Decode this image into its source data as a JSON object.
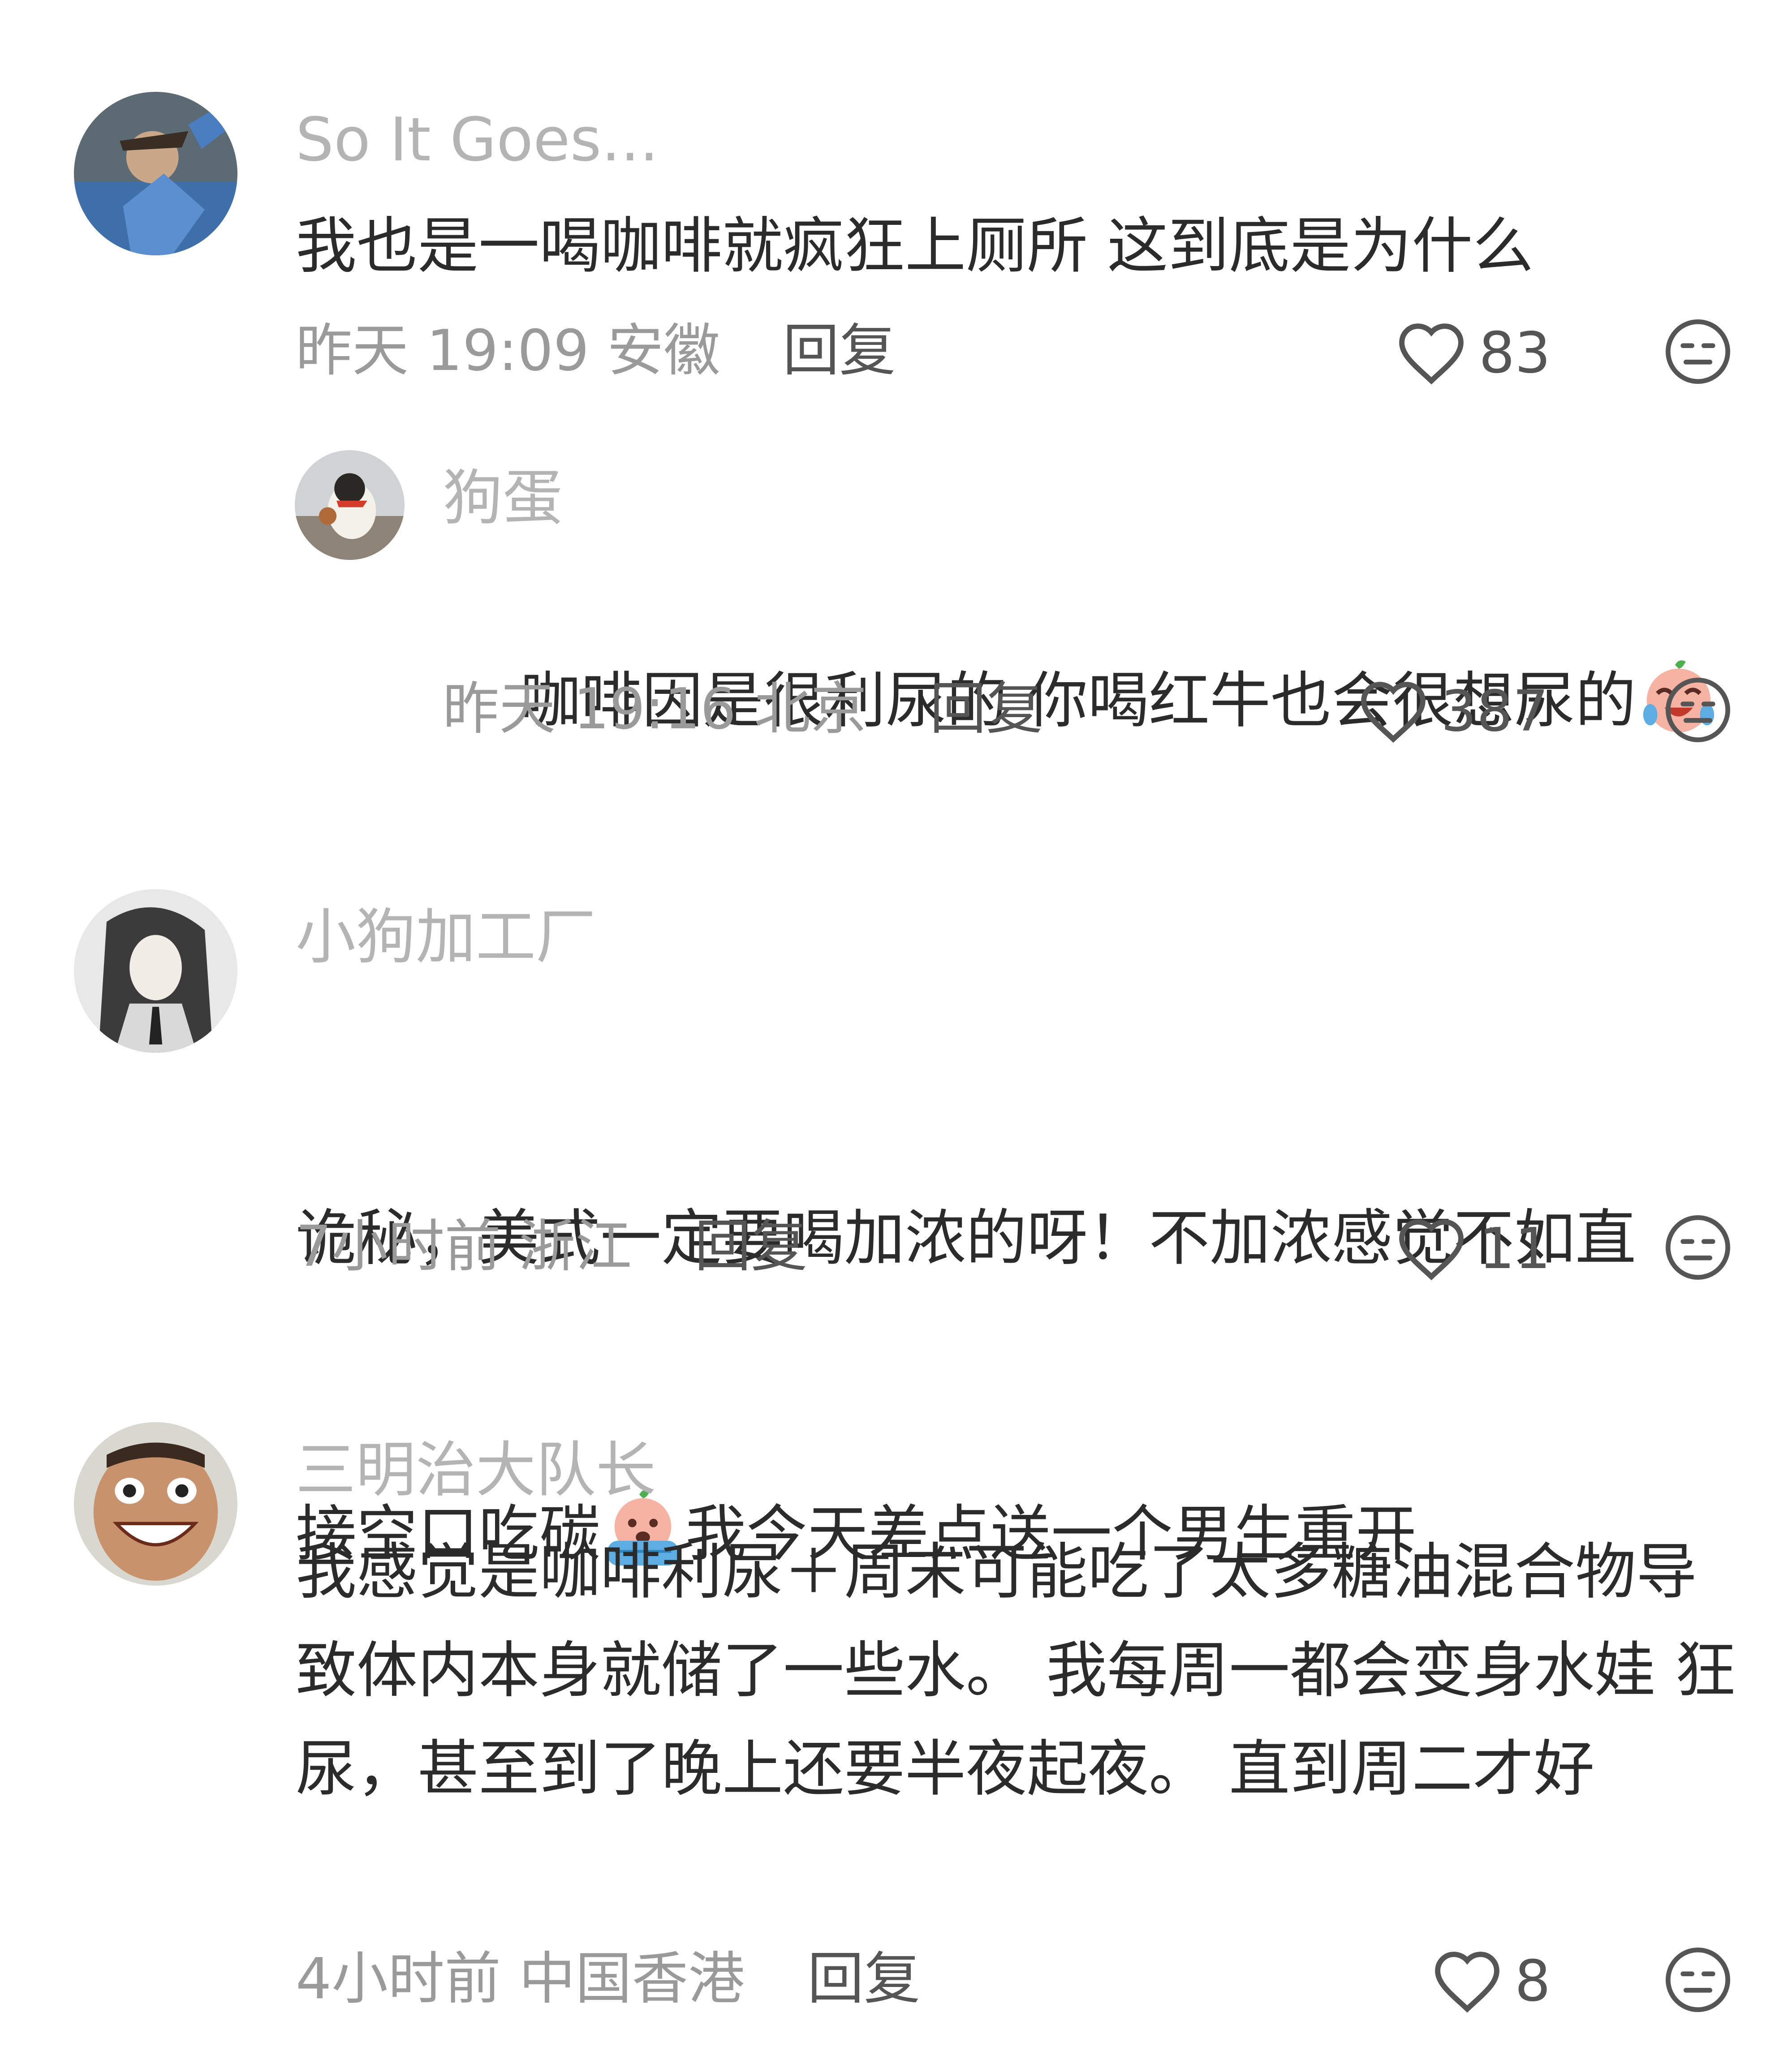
{
  "comments": [
    {
      "username": "So It Goes...",
      "text": "我也是一喝咖啡就疯狂上厕所 这到底是为什么",
      "time": "昨天 19:09",
      "location": "安徽",
      "reply_label": "回复",
      "likes": "83"
    },
    {
      "username": "狗蛋",
      "text": "咖啡因是很利尿的 你喝红牛也会很想尿的",
      "time": "昨天 19:16",
      "location": "北京",
      "reply_label": "回复",
      "likes": "387"
    },
    {
      "username": "小狗加工厂",
      "text_line1": "诡秘，美式一定要喝加浓的呀！不加浓感觉不如直",
      "text_line2_a": "接空口吃碳",
      "text_line2_b": "我今天差点送一个男生重开",
      "time": "7小时前",
      "location": "浙江",
      "reply_label": "回复",
      "likes": "11"
    },
    {
      "username": "三明治大队长",
      "text": "我感觉是咖啡利尿＋周末可能吃了太多糖油混合物导致体内本身就储了一些水。 我每周一都会变身水娃 狂尿，甚至到了晚上还要半夜起夜。 直到周二才好",
      "time": "4小时前",
      "location": "中国香港",
      "reply_label": "回复",
      "likes": "8"
    }
  ],
  "icons": {
    "like": "heart-outline-icon",
    "dislike": "meh-face-icon",
    "emoji_laugh_cry": "laughing-crying-emoji",
    "emoji_cry": "crying-emoji"
  },
  "colors": {
    "username": "#b4b4b4",
    "text": "#2b2b2b",
    "meta": "#9a9a9a",
    "reply": "#555555"
  }
}
